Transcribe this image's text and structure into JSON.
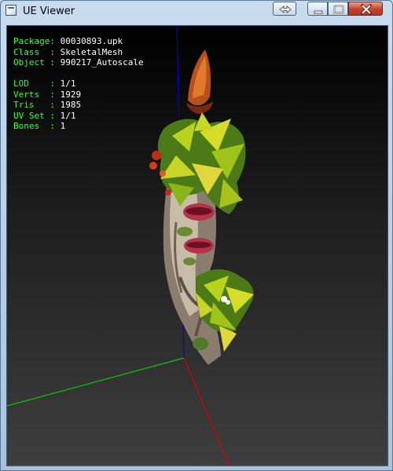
{
  "window": {
    "title": "UE Viewer",
    "controls": [
      "swap",
      "minimize",
      "maximize",
      "close"
    ]
  },
  "info": {
    "package_label": "Package",
    "package_value": "00030893.upk",
    "class_label": "Class",
    "class_value": "SkeletalMesh",
    "object_label": "Object",
    "object_value": "990217_Autoscale",
    "lod_label": "LOD",
    "lod_value": "1/1",
    "verts_label": "Verts",
    "verts_value": "1929",
    "tris_label": "Tris",
    "tris_value": "1985",
    "uvset_label": "UV Set",
    "uvset_value": "1/1",
    "bones_label": "Bones",
    "bones_value": "1"
  },
  "colors": {
    "label_green": "#35ff35",
    "value_white": "#ffffff",
    "axis_x": "#dd0000",
    "axis_y": "#00cc00",
    "axis_z": "#0000dd"
  }
}
